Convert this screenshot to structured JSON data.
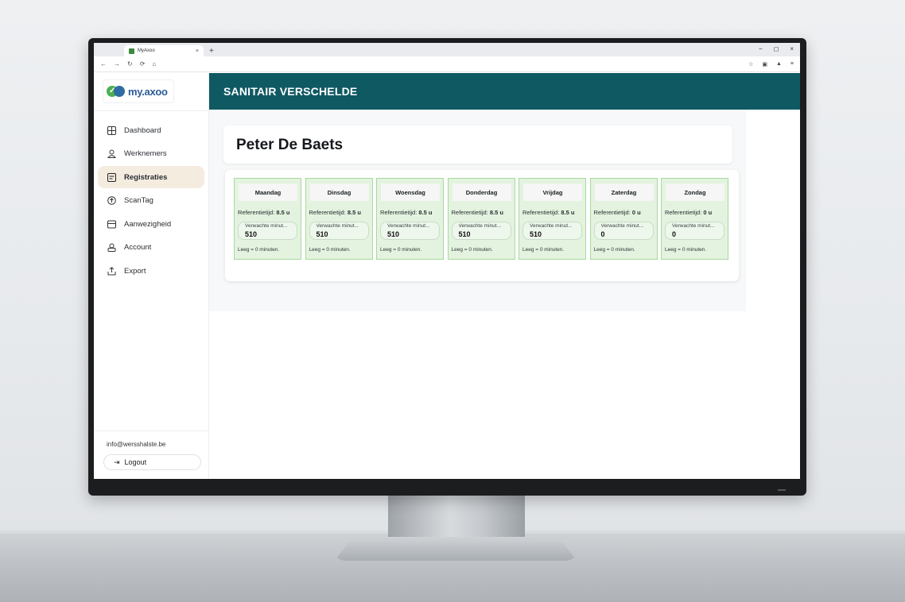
{
  "browser": {
    "tab_title": "MyAxoo",
    "tab_close": "×",
    "new_tab": "+",
    "url": "",
    "window_controls": [
      "−",
      "◻",
      "×"
    ]
  },
  "sidebar": {
    "logo_text": "my.axoo",
    "items": [
      {
        "label": "Dashboard",
        "icon": "dashboard-icon",
        "active": false
      },
      {
        "label": "Werknemers",
        "icon": "user-icon",
        "active": false
      },
      {
        "label": "Registraties",
        "icon": "registrations-icon",
        "active": true
      },
      {
        "label": "ScanTag",
        "icon": "scantag-icon",
        "active": false
      },
      {
        "label": "Aanwezigheid",
        "icon": "attendance-icon",
        "active": false
      },
      {
        "label": "Account",
        "icon": "account-icon",
        "active": false
      },
      {
        "label": "Export",
        "icon": "export-icon",
        "active": false
      }
    ],
    "email": "info@wersshalste.be",
    "logout_label": "Logout"
  },
  "header": {
    "title": "SANITAIR VERSCHELDE",
    "color": "#0f5963"
  },
  "employee": {
    "name": "Peter De Baets"
  },
  "days": [
    {
      "name": "Maandag",
      "ref_label": "Referentietijd:",
      "ref_value": "8.5 u",
      "expected_label": "Verwachte minut...",
      "expected_value": "510",
      "note": "Leeg = 0 minuten."
    },
    {
      "name": "Dinsdag",
      "ref_label": "Referentietijd:",
      "ref_value": "8.5 u",
      "expected_label": "Verwachte minut...",
      "expected_value": "510",
      "note": "Leeg = 0 minuten."
    },
    {
      "name": "Woensdag",
      "ref_label": "Referentietijd:",
      "ref_value": "8.5 u",
      "expected_label": "Verwachte minut...",
      "expected_value": "510",
      "note": "Leeg = 0 minuten."
    },
    {
      "name": "Donderdag",
      "ref_label": "Referentietijd:",
      "ref_value": "8.5 u",
      "expected_label": "Verwachte minut...",
      "expected_value": "510",
      "note": "Leeg = 0 minuten."
    },
    {
      "name": "Vrijdag",
      "ref_label": "Referentietijd:",
      "ref_value": "8.5 u",
      "expected_label": "Verwachte minut...",
      "expected_value": "510",
      "note": "Leeg = 0 minuten."
    },
    {
      "name": "Zaterdag",
      "ref_label": "Referentietijd:",
      "ref_value": "0 u",
      "expected_label": "Verwachte minut...",
      "expected_value": "0",
      "note": "Leeg = 0 minuten."
    },
    {
      "name": "Zondag",
      "ref_label": "Referentietijd:",
      "ref_value": "0 u",
      "expected_label": "Verwachte minut...",
      "expected_value": "0",
      "note": "Leeg = 0 minuten."
    }
  ]
}
